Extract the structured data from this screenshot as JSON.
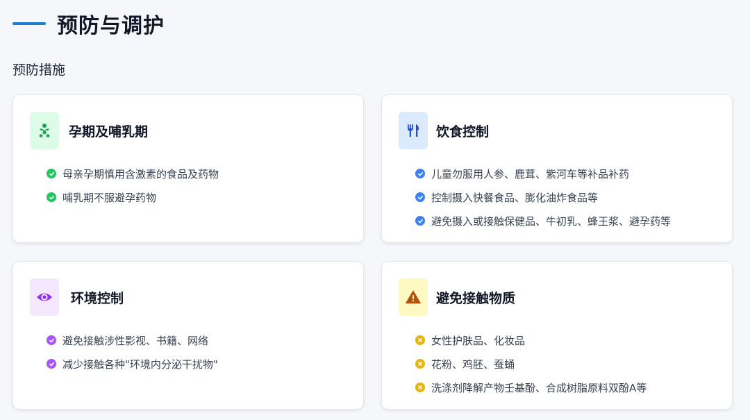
{
  "header": {
    "title": "预防与调护"
  },
  "section": {
    "subtitle": "预防措施"
  },
  "cards": [
    {
      "title": "孕期及哺乳期",
      "icon": "baby-icon",
      "accent": "#22c55e",
      "icon_bg": "#dcfce7",
      "items": [
        "母亲孕期慎用含激素的食品及药物",
        "哺乳期不服避孕药物"
      ]
    },
    {
      "title": "饮食控制",
      "icon": "utensils-icon",
      "accent": "#3b82f6",
      "icon_bg": "#dbeafe",
      "items": [
        "儿童勿服用人参、鹿茸、紫河车等补品补药",
        "控制摄入快餐食品、膨化油炸食品等",
        "避免摄入或接触保健品、牛初乳、蜂王浆、避孕药等"
      ]
    },
    {
      "title": "环境控制",
      "icon": "eye-icon",
      "accent": "#a855f7",
      "icon_bg": "#f3e8ff",
      "items": [
        "避免接触涉性影视、书籍、网络",
        "减少接触各种\"环境内分泌干扰物\""
      ]
    },
    {
      "title": "避免接触物质",
      "icon": "warning-icon",
      "accent": "#eab308",
      "icon_bg": "#fef9c3",
      "items": [
        "女性护肤品、化妆品",
        "花粉、鸡胚、蚕蛹",
        "洗涤剂降解产物壬基酚、合成树脂原料双酚A等"
      ]
    }
  ]
}
